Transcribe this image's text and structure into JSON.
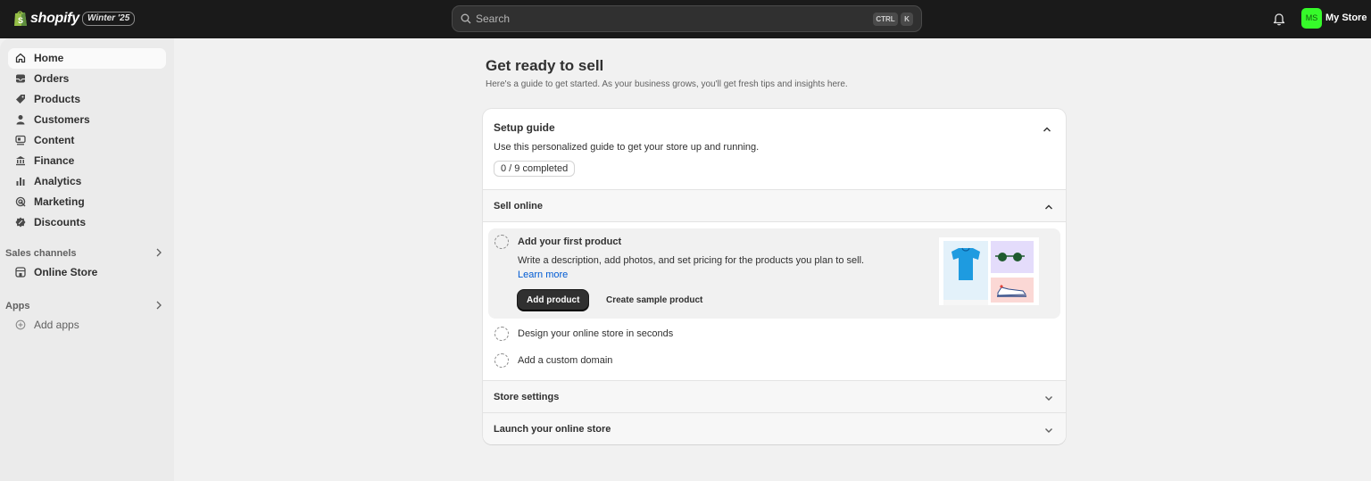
{
  "topbar": {
    "brand": "shopify",
    "edition_badge": "Winter '25",
    "search_placeholder": "Search",
    "shortcut_ctrl": "CTRL",
    "shortcut_key": "K",
    "avatar_initials": "MS",
    "store_name": "My Store",
    "icons": {
      "bell": "bell-icon",
      "search": "search-icon"
    }
  },
  "sidebar": {
    "items": [
      {
        "label": "Home",
        "icon": "home-icon",
        "active": true
      },
      {
        "label": "Orders",
        "icon": "inbox-icon"
      },
      {
        "label": "Products",
        "icon": "tag-icon"
      },
      {
        "label": "Customers",
        "icon": "person-icon"
      },
      {
        "label": "Content",
        "icon": "content-icon"
      },
      {
        "label": "Finance",
        "icon": "bank-icon"
      },
      {
        "label": "Analytics",
        "icon": "bar-chart-icon"
      },
      {
        "label": "Marketing",
        "icon": "target-icon"
      },
      {
        "label": "Discounts",
        "icon": "discount-icon"
      }
    ],
    "sales_channels_label": "Sales channels",
    "online_store_label": "Online Store",
    "apps_label": "Apps",
    "add_apps_label": "Add apps"
  },
  "main": {
    "title": "Get ready to sell",
    "subtitle": "Here's a guide to get started. As your business grows, you'll get fresh tips and insights here.",
    "setup_guide": {
      "title": "Setup guide",
      "description": "Use this personalized guide to get your store up and running.",
      "progress": "0 / 9 completed",
      "progress_value": {
        "completed": 0,
        "total": 9
      }
    },
    "sections": {
      "sell_online": "Sell online",
      "store_settings": "Store settings",
      "launch": "Launch your online store"
    },
    "first_task": {
      "title": "Add your first product",
      "description": "Write a description, add photos, and set pricing for the products you plan to sell.",
      "learn_more": "Learn more",
      "primary_button": "Add product",
      "secondary_button": "Create sample product"
    },
    "tasks": [
      "Design your online store in seconds",
      "Add a custom domain"
    ]
  },
  "colors": {
    "topbar": "#1a1a1a",
    "avatar": "#36fa2a",
    "link": "#005bd3",
    "primary_button": "#303030"
  }
}
